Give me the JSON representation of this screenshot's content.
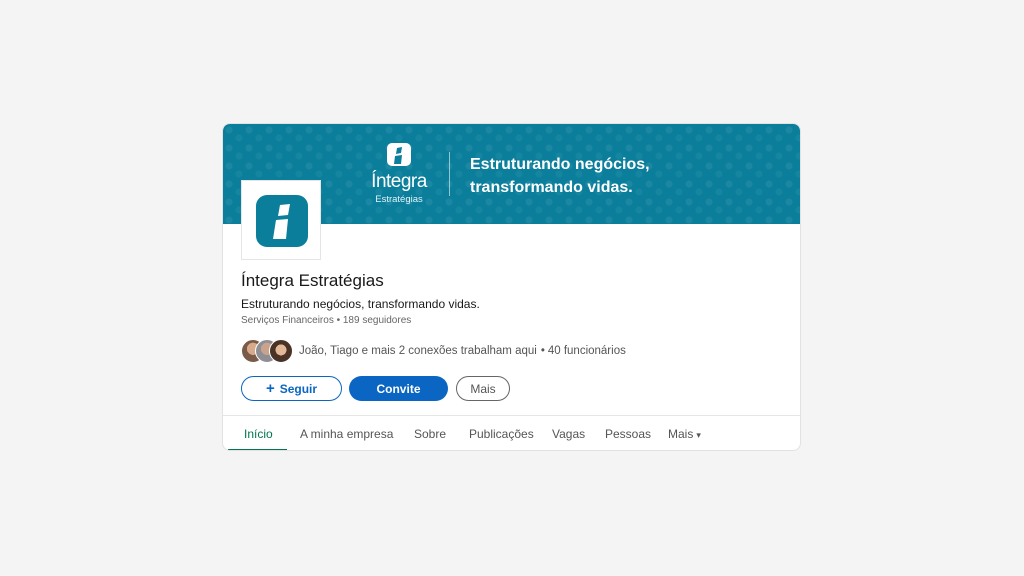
{
  "banner": {
    "brand_name": "Íntegra",
    "brand_sub": "Estratégias",
    "slogan_line1": "Estruturando negócios,",
    "slogan_line2": "transformando vidas."
  },
  "company": {
    "name": "Íntegra Estratégias",
    "tagline": "Estruturando negócios, transformando vidas.",
    "meta": "Serviços Financeiros • 189 seguidores"
  },
  "connections": {
    "text": "João, Tiago e mais 2 conexões trabalham aqui",
    "separator": "•",
    "employees": "40 funcionários"
  },
  "actions": {
    "follow_icon": "+",
    "follow_label": "Seguir",
    "invite_label": "Convite",
    "more_label": "Mais"
  },
  "tabs": [
    {
      "label": "Início",
      "active": true
    },
    {
      "label": "A minha empresa"
    },
    {
      "label": "Sobre"
    },
    {
      "label": "Publicações"
    },
    {
      "label": "Vagas"
    },
    {
      "label": "Pessoas"
    },
    {
      "label": "Mais",
      "caret": "▾"
    }
  ],
  "colors": {
    "banner": "#0a7e9b",
    "primary": "#0a66c2",
    "active_tab": "#01754f"
  },
  "icons": {
    "brand_logo": "integra-logo-icon",
    "company_logo": "integra-logo-icon"
  }
}
